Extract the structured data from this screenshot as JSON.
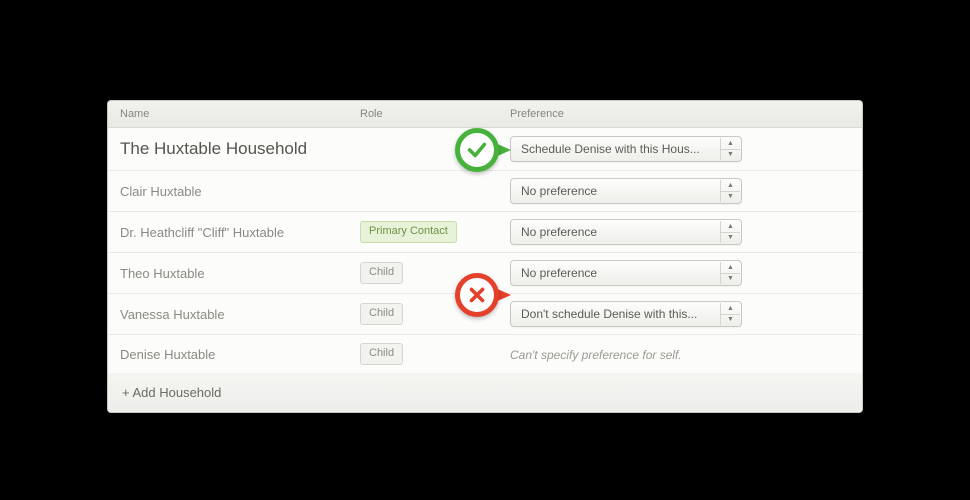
{
  "headers": {
    "name": "Name",
    "role": "Role",
    "preference": "Preference"
  },
  "household": {
    "title": "The Huxtable Household",
    "preference_select": "Schedule Denise with this Hous..."
  },
  "members": [
    {
      "name": "Clair Huxtable",
      "badge": null,
      "preference_select": "No preference"
    },
    {
      "name": "Dr. Heathcliff \"Cliff\" Huxtable",
      "badge": "Primary Contact",
      "badge_type": "primary",
      "preference_select": "No preference"
    },
    {
      "name": "Theo Huxtable",
      "badge": "Child",
      "badge_type": "child",
      "preference_select": "No preference"
    },
    {
      "name": "Vanessa Huxtable",
      "badge": "Child",
      "badge_type": "child",
      "preference_select": "Don't schedule Denise with this..."
    },
    {
      "name": "Denise Huxtable",
      "badge": "Child",
      "badge_type": "child",
      "preference_note": "Can't specify preference for self."
    }
  ],
  "footer": {
    "add_label": "+ Add Household"
  },
  "callouts": {
    "ok_icon": "checkmark-icon",
    "no_icon": "x-icon"
  }
}
